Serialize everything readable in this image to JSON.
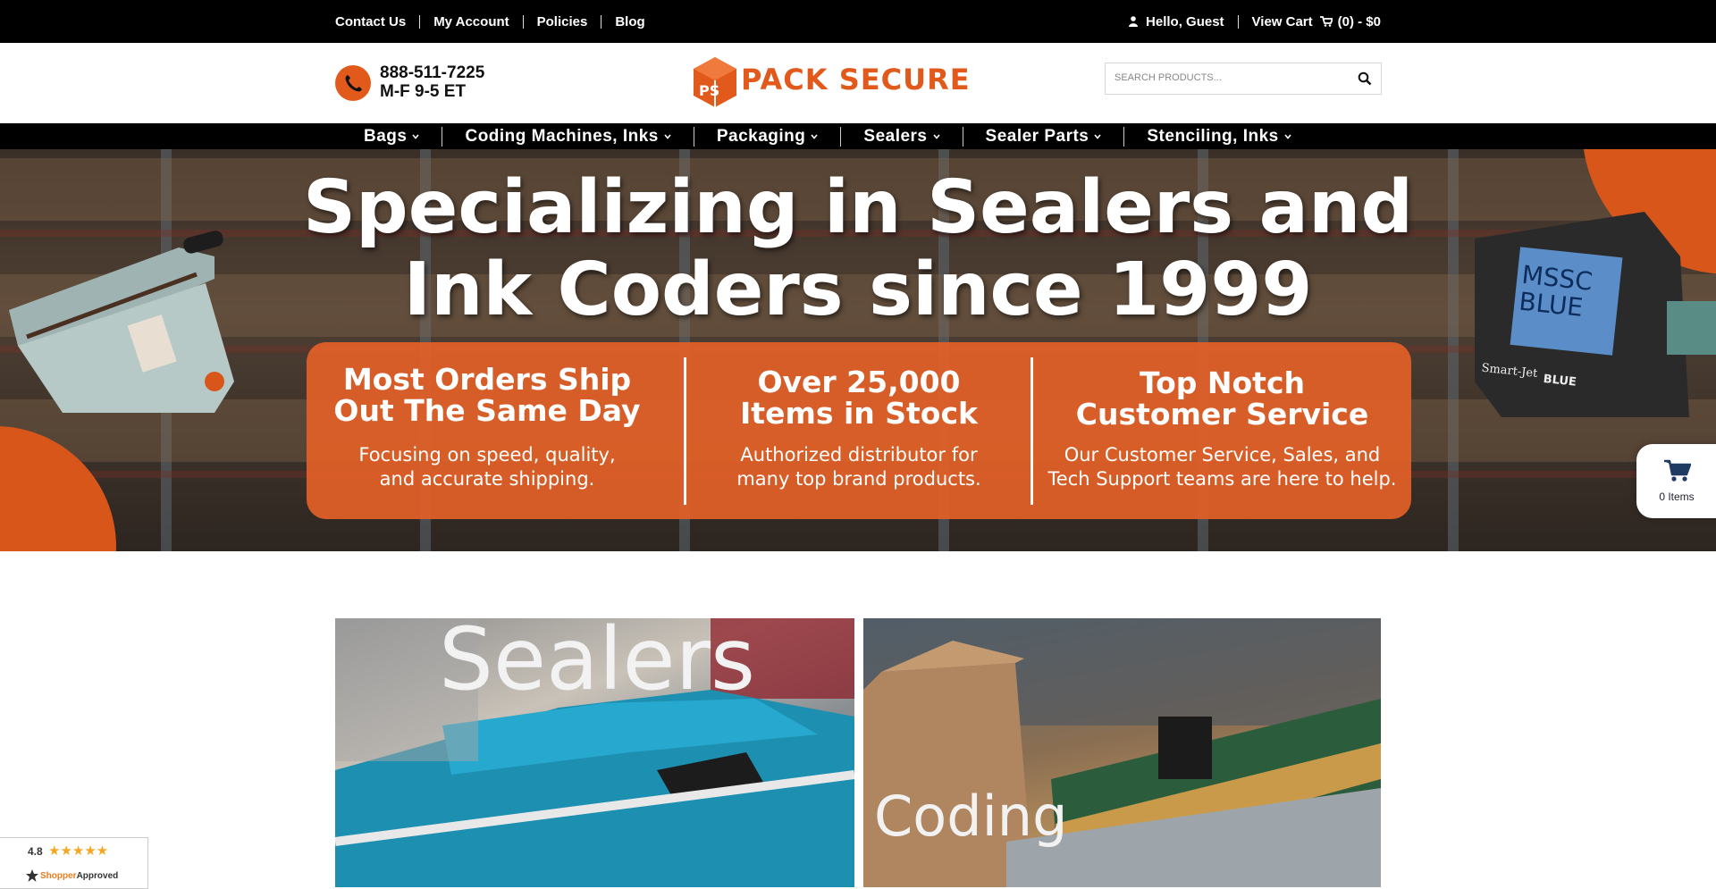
{
  "topbar": {
    "links": [
      "Contact Us",
      "My Account",
      "Policies",
      "Blog"
    ],
    "greeting": "Hello, Guest",
    "view_cart": "View Cart",
    "cart_summary": "(0) - $0"
  },
  "header": {
    "phone": "888-511-7225",
    "hours": "M-F 9-5 ET",
    "logo_text": "PACK SECURE",
    "logo_monogram": "PS",
    "search_placeholder": "SEARCH PRODUCTS..."
  },
  "nav": {
    "items": [
      "Bags",
      "Coding Machines, Inks",
      "Packaging",
      "Sealers",
      "Sealer Parts",
      "Stenciling, Inks"
    ]
  },
  "hero": {
    "title_line1": "Specializing in Sealers and",
    "title_line2": "Ink Coders since 1999",
    "features": [
      {
        "heading_line1": "Most Orders Ship",
        "heading_line2": "Out The Same Day",
        "text_line1": "Focusing on speed, quality,",
        "text_line2": "and accurate shipping."
      },
      {
        "heading_line1": "Over 25,000",
        "heading_line2": "Items in Stock",
        "text_line1": "Authorized distributor for",
        "text_line2": "many top brand products."
      },
      {
        "heading_line1": "Top Notch",
        "heading_line2": "Customer Service",
        "text_line1": "Our Customer Service, Sales, and",
        "text_line2": "Tech Support teams are here to help."
      }
    ],
    "coder_screen_text_1": "MSSC",
    "coder_screen_text_2": "BLUE",
    "coder_brand_1": "Smart-Jet",
    "coder_brand_2": "BLUE"
  },
  "floating_cart": {
    "label": "0 Items"
  },
  "categories": [
    {
      "label": "Sealers"
    },
    {
      "label": "Coding"
    }
  ],
  "rating": {
    "score": "4.8",
    "stars": "★★★★★",
    "brand_prefix": "Shopper",
    "brand_suffix": "Approved"
  },
  "colors": {
    "brand_orange": "#e25a1b",
    "topbar_bg": "#000000",
    "nav_bg": "#000000",
    "star_color": "#f5a623"
  },
  "icons": [
    "user-icon",
    "cart-icon",
    "phone-icon",
    "search-icon",
    "chevron-down-icon",
    "shopping-cart-icon",
    "star-icon"
  ]
}
